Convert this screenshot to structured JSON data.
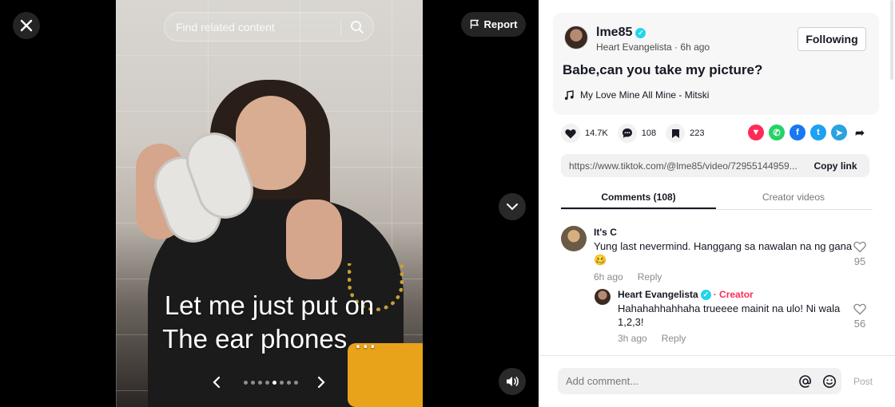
{
  "video": {
    "caption_line1": "Let me just put on",
    "caption_line2": "The ear phones ...",
    "search_placeholder": "Find related content",
    "report_label": "Report",
    "slide_count": 8,
    "active_slide": 5
  },
  "post": {
    "username": "lme85",
    "display_name": "Heart Evangelista",
    "time": "6h ago",
    "follow_label": "Following",
    "description": "Babe,can you take my picture?",
    "music": "My Love Mine All Mine - Mitski",
    "likes": "14.7K",
    "comments": "108",
    "saves": "223",
    "link": "https://www.tiktok.com/@lme85/video/72955144959...",
    "copy_label": "Copy link"
  },
  "tabs": [
    {
      "label": "Comments (108)"
    },
    {
      "label": "Creator videos"
    }
  ],
  "comments": [
    {
      "name": "It's C",
      "text": "Yung last nevermind. Hanggang sa nawalan na ng gana 🥴",
      "time": "6h ago",
      "reply": "Reply",
      "likes": "95"
    },
    {
      "name": "Heart Evangelista",
      "tag": "· Creator",
      "text": "Hahahahhahhaha trueeee mainit na ulo! Ni wala 1,2,3!",
      "time": "3h ago",
      "reply": "Reply",
      "likes": "56"
    }
  ],
  "comment_box": {
    "placeholder": "Add comment...",
    "post_label": "Post"
  },
  "colors": {
    "accent": "#fe2c55",
    "verified": "#20d5ec"
  }
}
